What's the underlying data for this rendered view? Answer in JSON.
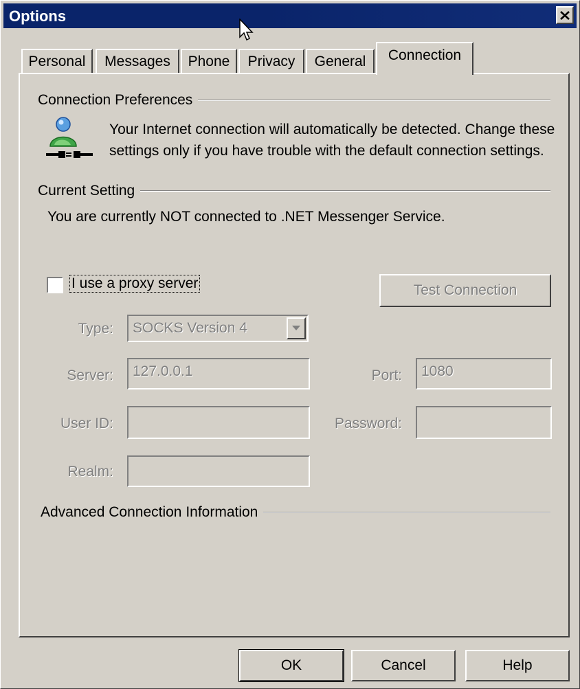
{
  "window": {
    "title": "Options"
  },
  "tabs": [
    {
      "label": "Personal"
    },
    {
      "label": "Messages"
    },
    {
      "label": "Phone"
    },
    {
      "label": "Privacy"
    },
    {
      "label": "General"
    },
    {
      "label": "Connection",
      "active": true
    }
  ],
  "preferences": {
    "heading": "Connection Preferences",
    "info": "Your Internet connection will automatically be detected.  Change these settings only if you have trouble with the default connection settings."
  },
  "current": {
    "heading": "Current Setting",
    "status": "You are currently NOT connected to .NET Messenger Service."
  },
  "proxy": {
    "checkbox_label": "I use a proxy server",
    "checked": false,
    "test_button": "Test Connection",
    "type_label": "Type:",
    "type_value": "SOCKS Version 4",
    "server_label": "Server:",
    "server_value": "127.0.0.1",
    "port_label": "Port:",
    "port_value": "1080",
    "userid_label": "User ID:",
    "userid_value": "",
    "password_label": "Password:",
    "password_value": "",
    "realm_label": "Realm:",
    "realm_value": ""
  },
  "advanced": {
    "heading": "Advanced Connection Information"
  },
  "footer": {
    "ok": "OK",
    "cancel": "Cancel",
    "help": "Help"
  },
  "colors": {
    "titlebar": "#0a246a",
    "face": "#d4d0c8",
    "disabled_text": "#808080"
  }
}
